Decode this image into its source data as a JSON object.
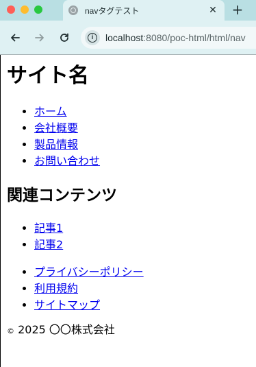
{
  "browser": {
    "tab_title": "navタグテスト",
    "tab_close": "✕",
    "new_tab": "+",
    "url_host": "localhost",
    "url_rest": ":8080/poc-html/html/nav"
  },
  "page": {
    "site_title": "サイト名",
    "nav_items": [
      {
        "label": "ホーム"
      },
      {
        "label": "会社概要"
      },
      {
        "label": "製品情報"
      },
      {
        "label": "お問い合わせ"
      }
    ],
    "aside_title": "関連コンテンツ",
    "aside_items": [
      {
        "label": "記事1"
      },
      {
        "label": "記事2"
      }
    ],
    "footer_items": [
      {
        "label": "プライバシーポリシー"
      },
      {
        "label": "利用規約"
      },
      {
        "label": "サイトマップ"
      }
    ],
    "copyright_symbol": "©",
    "copyright_text": " 2025 〇〇株式会社"
  },
  "colors": {
    "link": "#0000ee",
    "tab_strip": "#b9dfe3",
    "toolbar": "#dff1f3"
  },
  "icons": {
    "back": "arrow-left-icon",
    "forward": "arrow-right-icon",
    "reload": "reload-icon",
    "site_info": "info-icon"
  }
}
